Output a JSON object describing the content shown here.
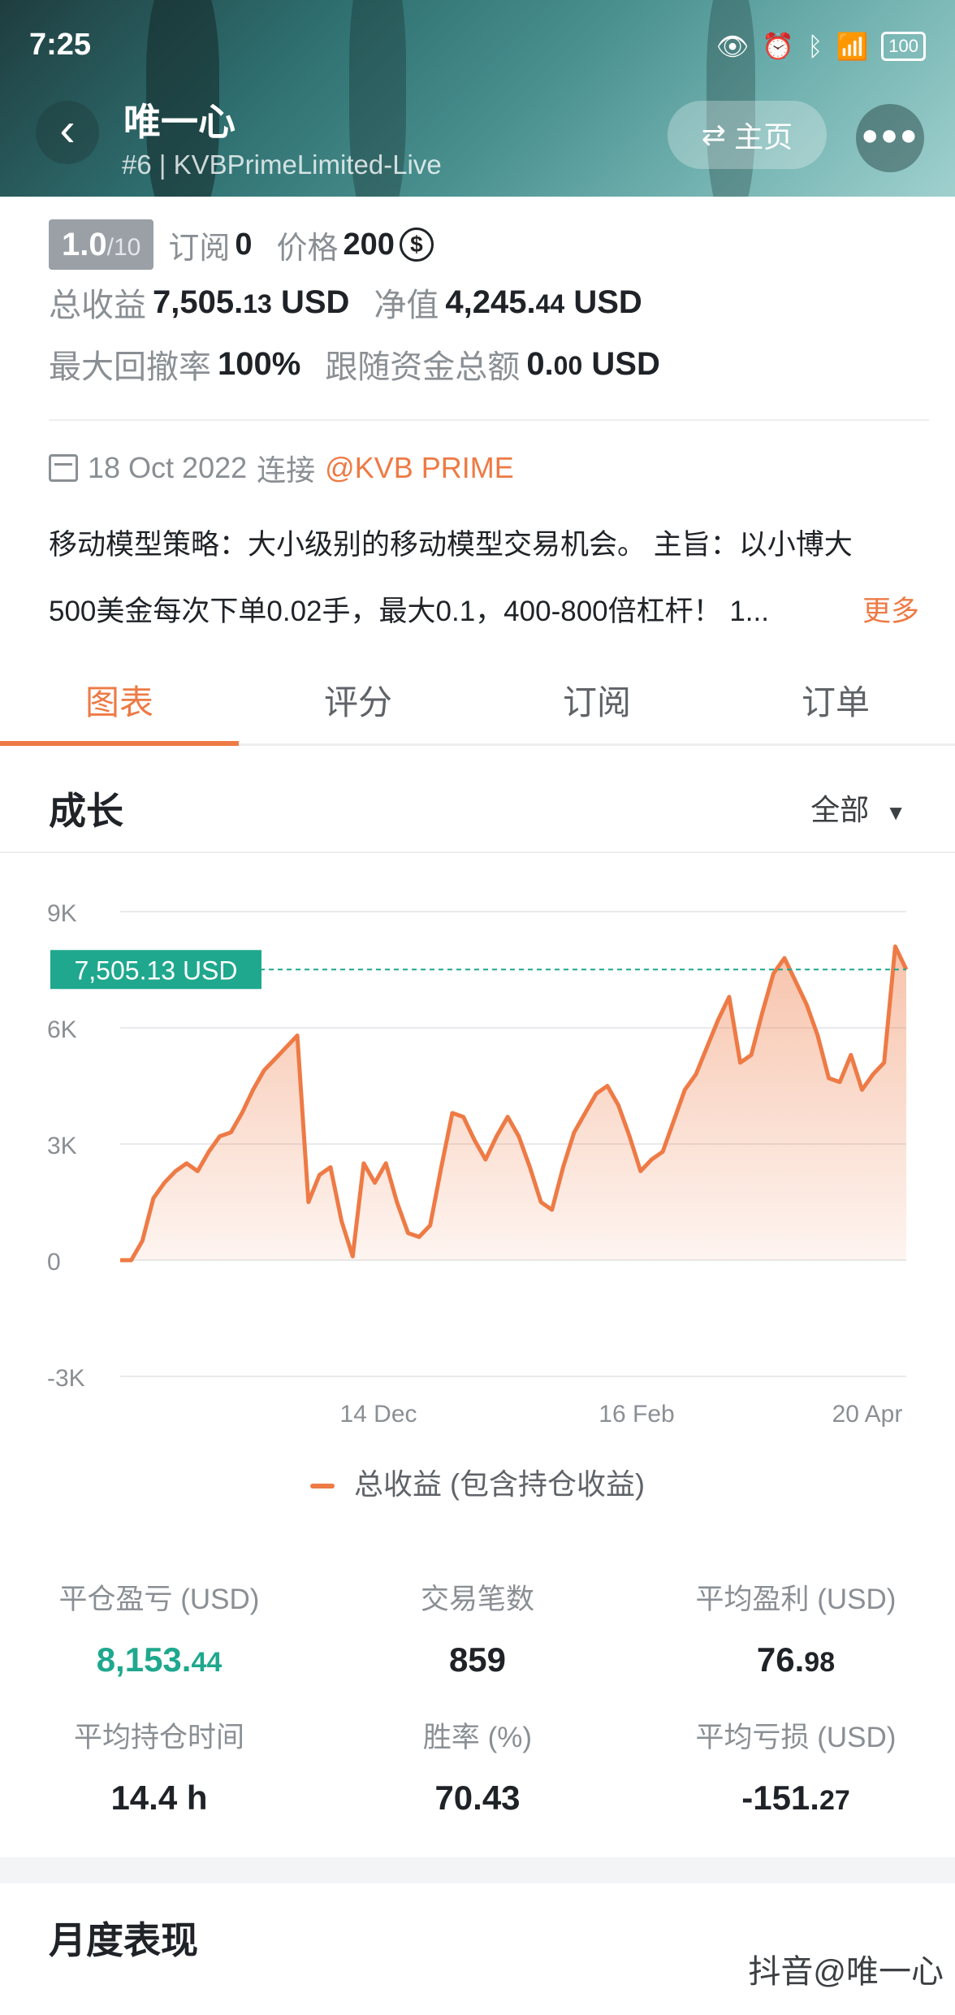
{
  "status_bar": {
    "time": "7:25",
    "battery": "100"
  },
  "header": {
    "name": "唯一心",
    "subtitle": "#6 | KVBPrimeLimited-Live",
    "home_label": "主页",
    "back_icon": "back-arrow-icon",
    "more_icon": "more-dots-icon"
  },
  "info": {
    "score_main": "1.0",
    "score_sub": "/10",
    "subscribe_label": "订阅",
    "subscribe_value": "0",
    "price_label": "价格",
    "price_value": "200",
    "price_coin": "$",
    "total_profit_label": "总收益",
    "total_profit_int": "7,505.",
    "total_profit_dec": "13",
    "total_profit_unit": "USD",
    "net_label": "净值",
    "net_int": "4,245.",
    "net_dec": "44",
    "net_unit": "USD",
    "drawdown_label": "最大回撤率",
    "drawdown_value": "100%",
    "follow_label": "跟随资金总额",
    "follow_int": "0.",
    "follow_dec": "00",
    "follow_unit": "USD"
  },
  "connect": {
    "date": "18 Oct 2022",
    "label": "连接",
    "broker": "@KVB PRIME"
  },
  "description": {
    "line1": "移动模型策略：大小级别的移动模型交易机会。 主旨：以小博大",
    "line2": "500美金每次下单0.02手，最大0.1，400-800倍杠杆！ 1...",
    "more": "更多"
  },
  "tabs": [
    {
      "label": "图表",
      "active": true
    },
    {
      "label": "评分",
      "active": false
    },
    {
      "label": "订阅",
      "active": false
    },
    {
      "label": "订单",
      "active": false
    }
  ],
  "growth": {
    "title": "成长",
    "range": "全部"
  },
  "chart_data": {
    "type": "area",
    "current_label": "7,505.13 USD",
    "current_value": 7505.13,
    "y_ticks": [
      "9K",
      "6K",
      "3K",
      "0",
      "-3K"
    ],
    "x_ticks": [
      "14 Dec",
      "16 Feb",
      "20 Apr"
    ],
    "ylim": [
      -3000,
      9000
    ],
    "series": [
      {
        "name": "总收益 (包含持仓收益)",
        "values": [
          0,
          0,
          500,
          1600,
          2000,
          2300,
          2500,
          2300,
          2800,
          3200,
          3300,
          3800,
          4400,
          4900,
          5200,
          5500,
          5800,
          1500,
          2200,
          2400,
          1000,
          100,
          2500,
          2000,
          2500,
          1500,
          700,
          600,
          900,
          2400,
          3800,
          3700,
          3100,
          2600,
          3200,
          3700,
          3200,
          2400,
          1500,
          1300,
          2400,
          3300,
          3800,
          4300,
          4500,
          4000,
          3200,
          2300,
          2600,
          2800,
          3600,
          4400,
          4800,
          5500,
          6200,
          6800,
          5100,
          5300,
          6400,
          7400,
          7800,
          7200,
          6600,
          5800,
          4700,
          4600,
          5300,
          4400,
          4800,
          5100,
          8100,
          7505
        ]
      }
    ],
    "color": "#ee7a45",
    "current_color": "#1fa88e"
  },
  "legend": {
    "label": "总收益 (包含持仓收益)"
  },
  "stats": [
    {
      "label": "平仓盈亏 (USD)",
      "int": "8,153.",
      "dec": "44",
      "green": true
    },
    {
      "label": "交易笔数",
      "int": "859",
      "dec": "",
      "green": false
    },
    {
      "label": "平均盈利 (USD)",
      "int": "76.",
      "dec": "98",
      "green": false
    },
    {
      "label": "平均持仓时间",
      "int": "14.4 h",
      "dec": "",
      "green": false
    },
    {
      "label": "胜率 (%)",
      "int": "70.43",
      "dec": "",
      "green": false
    },
    {
      "label": "平均亏损 (USD)",
      "int": "-151.",
      "dec": "27",
      "green": false
    }
  ],
  "monthly": {
    "title": "月度表现"
  },
  "watermark": "抖音@唯一心"
}
